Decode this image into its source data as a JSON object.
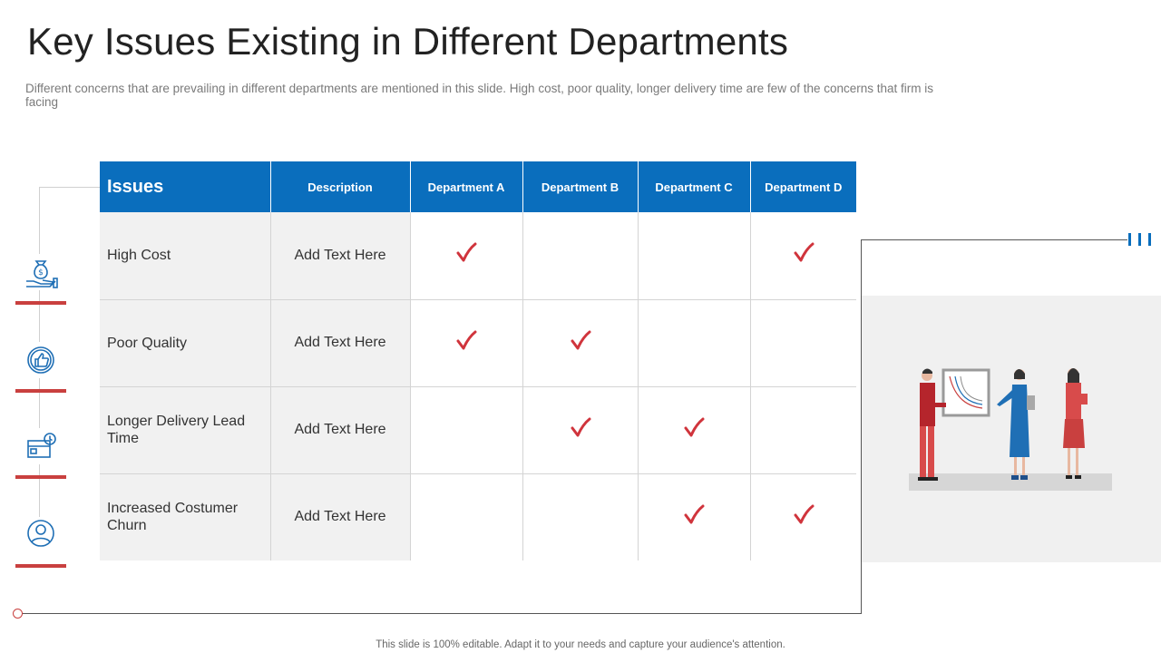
{
  "slide": {
    "title": "Key Issues Existing in Different Departments",
    "subtitle": "Different concerns that are  prevailing in different departments are mentioned in this slide. High cost, poor quality, longer delivery time are few of the concerns that firm is facing",
    "footer": "This slide is 100% editable. Adapt it to your needs and capture your audience's attention."
  },
  "table": {
    "headers": [
      "Issues",
      "Description",
      "Department A",
      "Department B",
      "Department C",
      "Department D"
    ],
    "rows": [
      {
        "issue": "High Cost",
        "description": "Add Text Here",
        "checks": [
          true,
          false,
          false,
          true
        ]
      },
      {
        "issue": "Poor Quality",
        "description": "Add Text Here",
        "checks": [
          true,
          true,
          false,
          false
        ]
      },
      {
        "issue": "Longer Delivery Lead Time",
        "description": "Add Text Here",
        "checks": [
          false,
          true,
          true,
          false
        ]
      },
      {
        "issue": "Increased Costumer Churn",
        "description": "Add Text Here",
        "checks": [
          false,
          false,
          true,
          true
        ]
      }
    ]
  },
  "icons": [
    "money-bag-hand-icon",
    "thumbs-up-icon",
    "delivery-box-icon",
    "customer-icon"
  ],
  "colors": {
    "header_blue": "#0a6ebd",
    "accent_red": "#c9403f",
    "check_red": "#d0343c",
    "icon_blue": "#1f6fb5"
  }
}
